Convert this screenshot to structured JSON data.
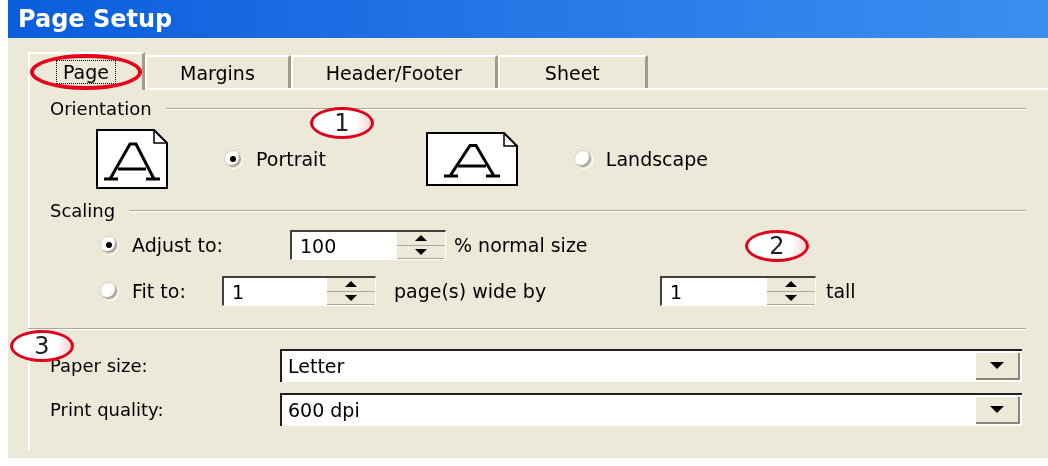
{
  "window": {
    "title": "Page Setup"
  },
  "tabs": [
    {
      "label": "Page",
      "selected": true,
      "circled": true
    },
    {
      "label": "Margins",
      "selected": false,
      "circled": false
    },
    {
      "label": "Header/Footer",
      "selected": false,
      "circled": false
    },
    {
      "label": "Sheet",
      "selected": false,
      "circled": false
    }
  ],
  "orientation": {
    "label": "Orientation",
    "callout": "1",
    "options": [
      {
        "kind": "portrait",
        "label": "Portrait",
        "selected": true
      },
      {
        "kind": "landscape",
        "label": "Landscape",
        "selected": false
      }
    ]
  },
  "scaling": {
    "label": "Scaling",
    "callout": "2",
    "adjust": {
      "label": "Adjust to:",
      "selected": true,
      "value": "100",
      "suffix": "% normal size"
    },
    "fit": {
      "label": "Fit to:",
      "selected": false,
      "wide_value": "1",
      "wide_suffix": "page(s) wide by",
      "tall_value": "1",
      "tall_suffix": "tall"
    }
  },
  "paper": {
    "callout": "3",
    "fields": [
      {
        "label": "Paper size:",
        "value": "Letter"
      },
      {
        "label": "Print quality:",
        "value": "600 dpi"
      }
    ]
  }
}
